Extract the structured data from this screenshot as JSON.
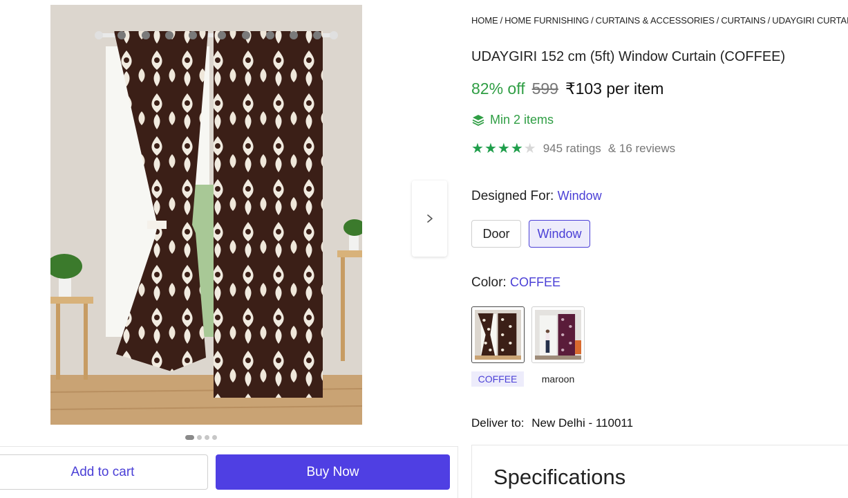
{
  "breadcrumb": {
    "items": [
      "HOME",
      "HOME FURNISHING",
      "CURTAINS & ACCESSORIES",
      "CURTAINS",
      "UDAYGIRI CURTAIN"
    ],
    "separator": "/"
  },
  "product": {
    "title": "UDAYGIRI 152 cm (5ft) Window Curtain (COFFEE)",
    "discount": "82% off",
    "mrp": "599",
    "price": "₹103 per item",
    "min_items": "Min 2 items",
    "rating_value": 4,
    "rating_max": 5,
    "ratings_text": "945 ratings",
    "reviews_text": "& 16 reviews"
  },
  "designed_for": {
    "label": "Designed For:",
    "selected": "Window",
    "options": [
      "Door",
      "Window"
    ]
  },
  "color": {
    "label": "Color:",
    "selected": "COFFEE",
    "options": [
      "COFFEE",
      "maroon"
    ]
  },
  "delivery": {
    "label": "Deliver to:",
    "location": "New Delhi - 110011"
  },
  "actions": {
    "add_to_cart": "Add to cart",
    "buy_now": "Buy Now"
  },
  "specifications": {
    "title": "Specifications"
  },
  "carousel": {
    "total": 4,
    "active": 1,
    "next_icon": "chevron-right-icon"
  },
  "colors": {
    "accent": "#4f3fe3",
    "link": "#4a3fd6",
    "green": "#2f9e44",
    "rating_green": "#1f9e4b"
  }
}
